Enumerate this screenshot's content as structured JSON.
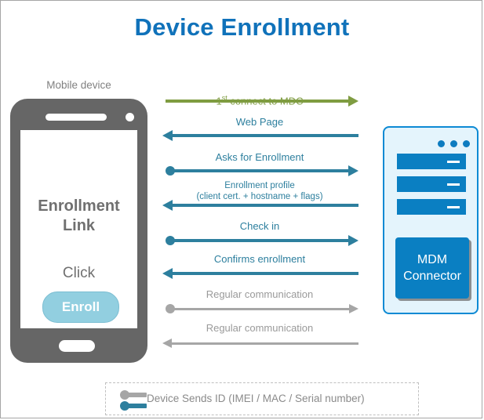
{
  "page": {
    "title": "Device Enrollment",
    "title_color": "#1072ba"
  },
  "mobile": {
    "caption": "Mobile device",
    "screen_title_line1": "Enrollment",
    "screen_title_line2": "Link",
    "click_label": "Click",
    "button_label": "Enroll",
    "button_color": "#92cfe0"
  },
  "server": {
    "box_label_line1": "MDM",
    "box_label_line2": "Connector",
    "body_color": "#e4f4fc",
    "border_color": "#0d8ad4",
    "bar_color": "#0a7fc2",
    "dot_count": 3,
    "bar_count": 3
  },
  "flow": {
    "steps": [
      {
        "label": "1st connect to MDC",
        "label_sup": "st",
        "label_pre": "1",
        "label_post": " connect to MDC",
        "direction": "right",
        "color": "#7f9c41",
        "origin_dot": false
      },
      {
        "label": "Web Page",
        "direction": "left",
        "color": "#2d7f9e",
        "origin_dot": false
      },
      {
        "label": "Asks for Enrollment",
        "direction": "right",
        "color": "#2d7f9e",
        "origin_dot": true
      },
      {
        "label": "Enrollment profile\n(client cert. + hostname + flags)",
        "direction": "left",
        "color": "#2d7f9e",
        "origin_dot": false
      },
      {
        "label": "Check in",
        "direction": "right",
        "color": "#2d7f9e",
        "origin_dot": true
      },
      {
        "label": "Confirms enrollment",
        "direction": "left",
        "color": "#2d7f9e",
        "origin_dot": false
      },
      {
        "label": "Regular communication",
        "direction": "right",
        "color": "#a6a6a6",
        "origin_dot": true
      },
      {
        "label": "Regular communication",
        "direction": "left",
        "color": "#a6a6a6",
        "origin_dot": false
      }
    ]
  },
  "legend": {
    "text": "Device Sends ID (IMEI / MAC / Serial number)",
    "mark_colors": [
      "#a6a6a6",
      "#2d7f9e"
    ]
  }
}
